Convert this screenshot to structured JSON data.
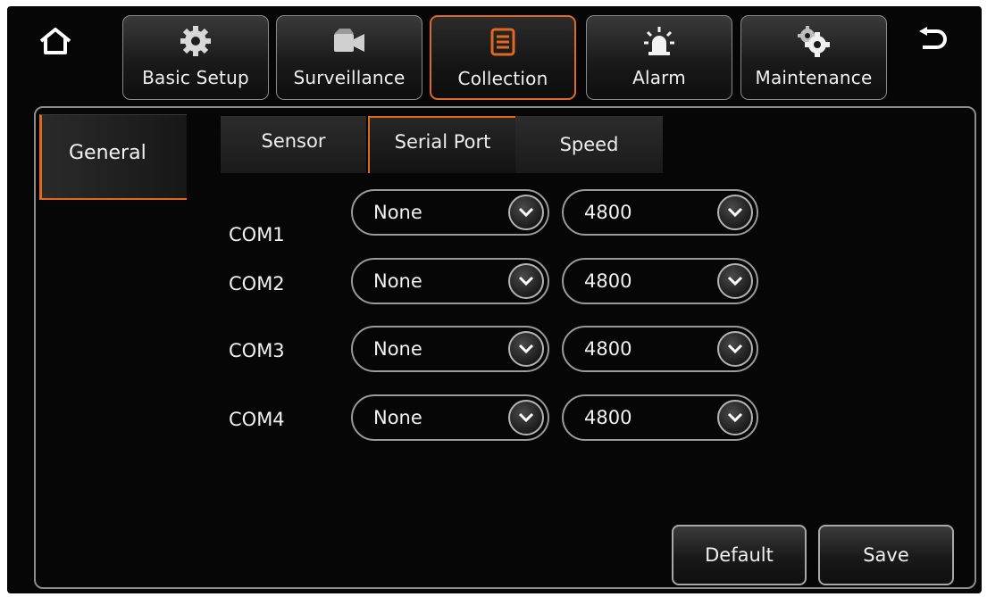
{
  "nav": {
    "items": [
      {
        "label": "Basic Setup",
        "icon": "gear-icon"
      },
      {
        "label": "Surveillance",
        "icon": "video-camera-icon"
      },
      {
        "label": "Collection",
        "icon": "collection-icon"
      },
      {
        "label": "Alarm",
        "icon": "alarm-light-icon"
      },
      {
        "label": "Maintenance",
        "icon": "maintenance-gears-icon"
      }
    ],
    "active_index": 2
  },
  "side": {
    "items": [
      {
        "label": "General"
      }
    ]
  },
  "tabs": [
    {
      "label": "Sensor"
    },
    {
      "label": "Serial Port"
    },
    {
      "label": "Speed"
    }
  ],
  "rows": [
    {
      "label": "COM1",
      "device": "None",
      "baud": "4800"
    },
    {
      "label": "COM2",
      "device": "None",
      "baud": "4800"
    },
    {
      "label": "COM3",
      "device": "None",
      "baud": "4800"
    },
    {
      "label": "COM4",
      "device": "None",
      "baud": "4800"
    }
  ],
  "buttons": {
    "default": "Default",
    "save": "Save"
  },
  "colors": {
    "accent": "#e0681f",
    "border": "#8c8c8c",
    "background": "#060606"
  }
}
